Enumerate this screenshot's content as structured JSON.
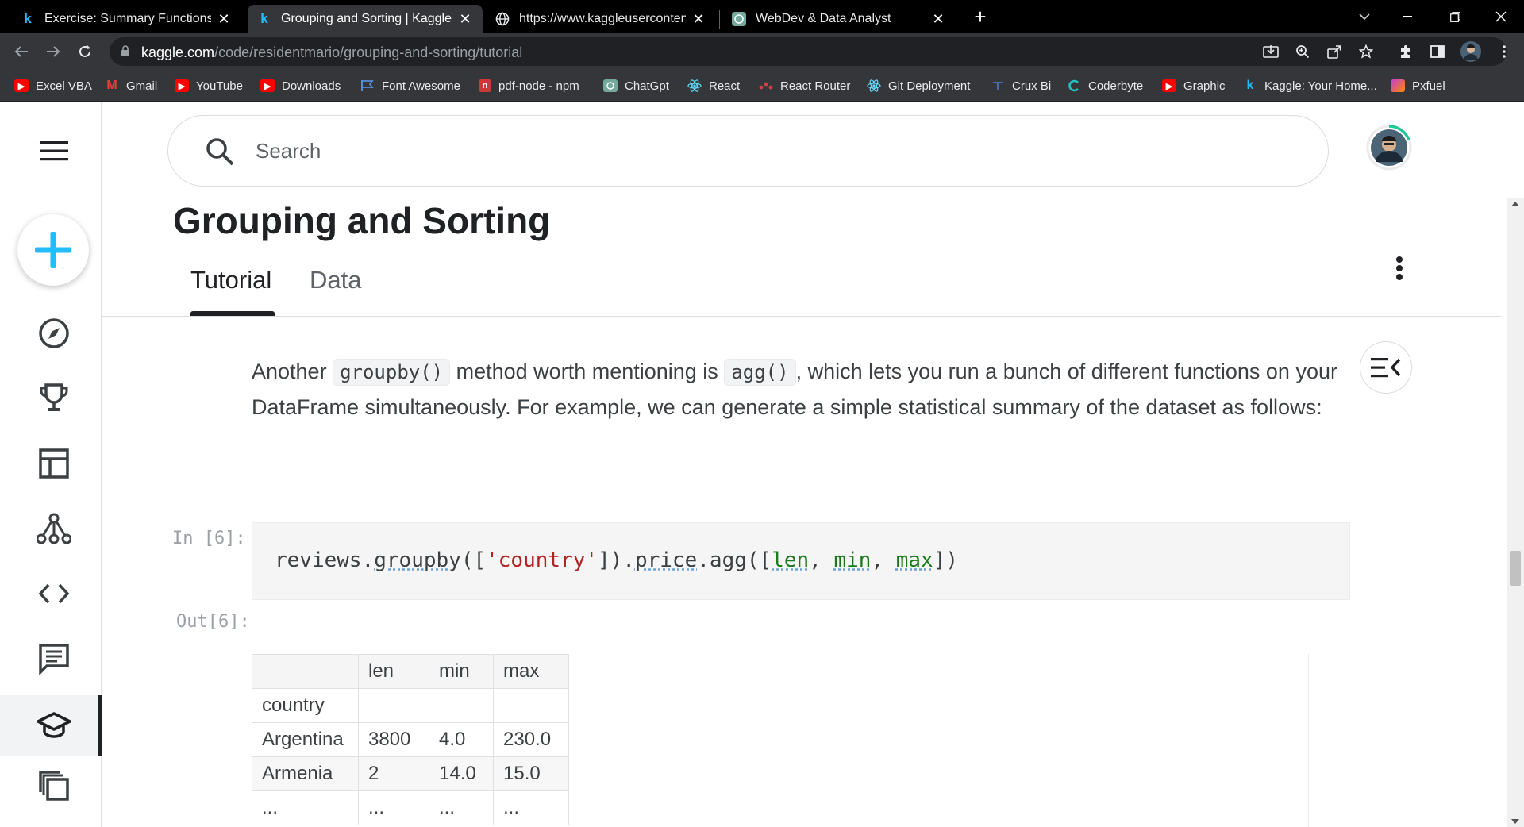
{
  "browser": {
    "tabs": [
      {
        "favicon": "kaggle-icon",
        "title": "Exercise: Summary Functions and",
        "active": false
      },
      {
        "favicon": "kaggle-icon",
        "title": "Grouping and Sorting | Kaggle",
        "active": true
      },
      {
        "favicon": "globe-icon",
        "title": "https://www.kaggleusercontent.c",
        "active": false
      },
      {
        "favicon": "chatgpt-icon",
        "title": "WebDev & Data Analyst",
        "active": false
      }
    ],
    "url_host": "kaggle.com",
    "url_path": "/code/residentmario/grouping-and-sorting/tutorial",
    "bookmarks": [
      {
        "label": "Excel VBA",
        "icon": "youtube-icon",
        "color": "#ff0000"
      },
      {
        "label": "Gmail",
        "icon": "gmail-icon",
        "color": "#ea4335"
      },
      {
        "label": "YouTube",
        "icon": "youtube-icon",
        "color": "#ff0000"
      },
      {
        "label": "Downloads",
        "icon": "youtube-icon",
        "color": "#ff0000"
      },
      {
        "label": "Font Awesome",
        "icon": "flag-icon",
        "color": "#538dd7"
      },
      {
        "label": "pdf-node - npm",
        "icon": "npm-icon",
        "color": "#cb3837"
      },
      {
        "label": "ChatGpt",
        "icon": "chatgpt-icon",
        "color": "#74aa9c"
      },
      {
        "label": "React",
        "icon": "react-icon",
        "color": "#61dafb"
      },
      {
        "label": "React Router",
        "icon": "react-router-icon",
        "color": "#ca4245"
      },
      {
        "label": "Git Deployment",
        "icon": "react-icon",
        "color": "#61dafb"
      },
      {
        "label": "Crux Bi",
        "icon": "crux-icon",
        "color": "#4a6da7"
      },
      {
        "label": "Coderbyte",
        "icon": "coderbyte-icon",
        "color": "#22c3c3"
      },
      {
        "label": "Graphic",
        "icon": "youtube-icon",
        "color": "#ff0000"
      },
      {
        "label": "Kaggle: Your Home...",
        "icon": "kaggle-icon",
        "color": "#20beff"
      },
      {
        "label": "Pxfuel",
        "icon": "pxfuel-icon",
        "color": "#c33cd5"
      }
    ]
  },
  "kaggle": {
    "search_placeholder": "Search",
    "page_title": "Grouping and Sorting",
    "tabs": [
      {
        "label": "Tutorial",
        "active": true
      },
      {
        "label": "Data",
        "active": false
      }
    ],
    "prose": {
      "t1": "Another ",
      "code1": "groupby()",
      "t2": " method worth mentioning is ",
      "code2": "agg()",
      "t3": ", which lets you run a bunch of different functions on your DataFrame simultaneously. For example, we can generate a simple statistical summary of the dataset as follows:"
    },
    "cell": {
      "in_prompt": "In [6]:",
      "out_prompt": "Out[6]:",
      "code": {
        "p1": "reviews.",
        "fn1": "groupby",
        "p2": "([",
        "str1": "'country'",
        "p3": "]).",
        "fn2": "price",
        "p4": ".agg([",
        "kw1": "len",
        "p5": ", ",
        "kw2": "min",
        "p6": ", ",
        "kw3": "max",
        "p7": "])"
      }
    },
    "output_table": {
      "columns": [
        "",
        "len",
        "min",
        "max"
      ],
      "index_name": "country",
      "rows": [
        [
          "Argentina",
          "3800",
          "4.0",
          "230.0"
        ],
        [
          "Armenia",
          "2",
          "14.0",
          "15.0"
        ],
        [
          "...",
          "...",
          "...",
          "..."
        ]
      ]
    },
    "colors": {
      "brand_blue": "#20beff",
      "text": "#202124",
      "muted": "#5f6368"
    }
  }
}
